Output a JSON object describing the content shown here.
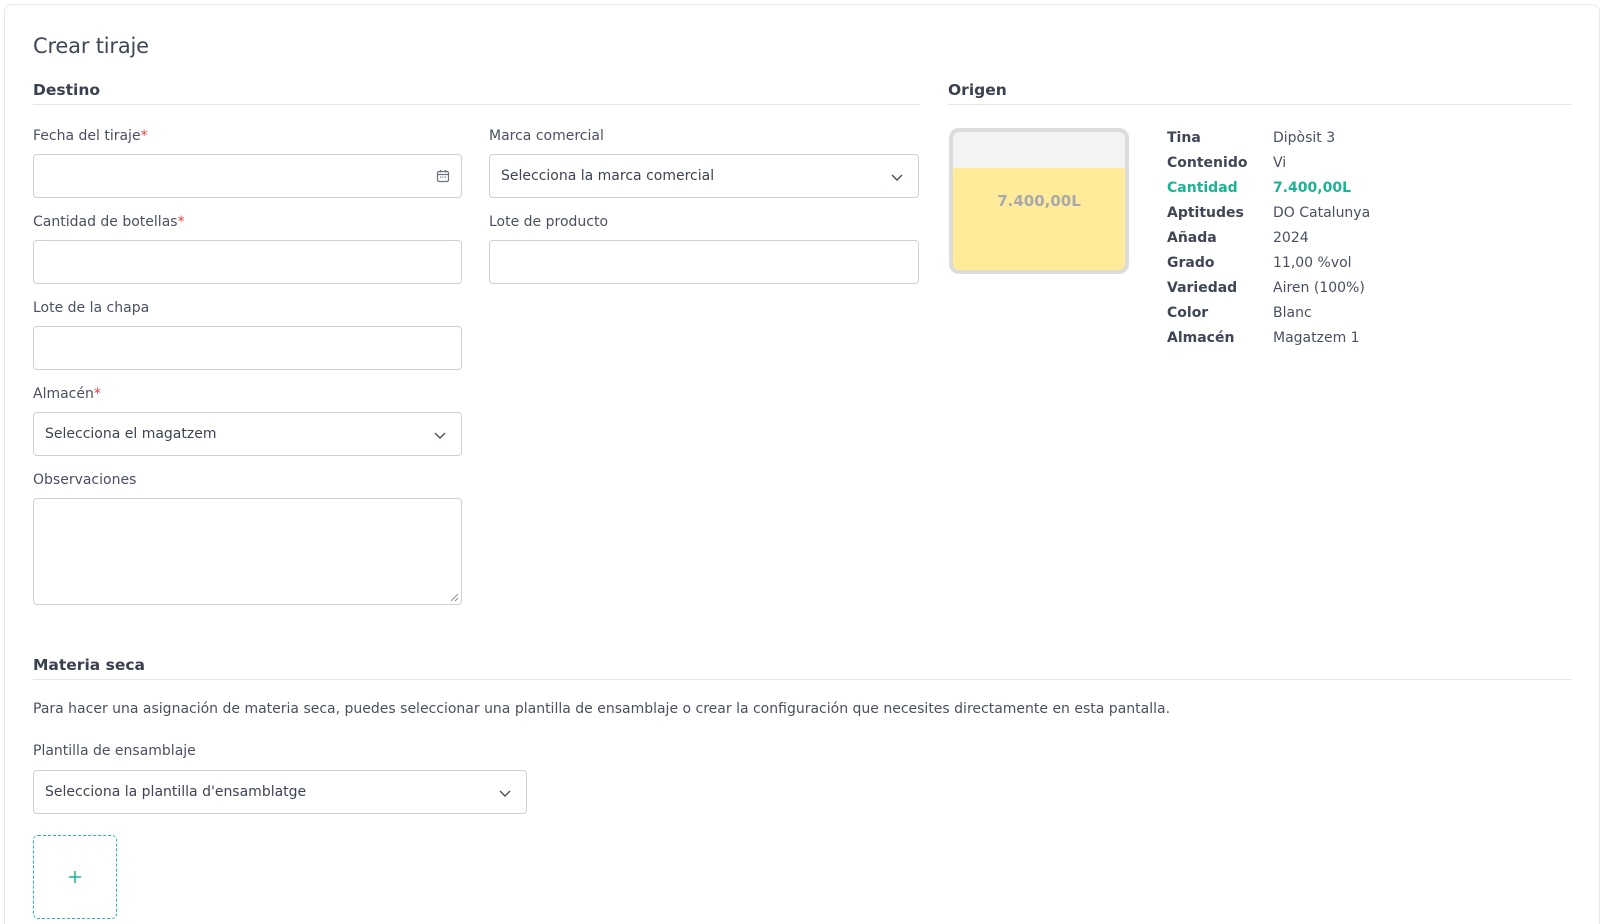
{
  "page": {
    "title": "Crear tiraje"
  },
  "destino": {
    "section_title": "Destino",
    "fecha": {
      "label": "Fecha del tiraje",
      "required_mark": "*",
      "value": ""
    },
    "marca": {
      "label": "Marca comercial",
      "placeholder": "Selecciona la marca comercial"
    },
    "botellas": {
      "label": "Cantidad de botellas",
      "required_mark": "*",
      "value": ""
    },
    "lote_producto": {
      "label": "Lote de producto",
      "value": ""
    },
    "lote_chapa": {
      "label": "Lote de la chapa",
      "value": ""
    },
    "almacen": {
      "label": "Almacén",
      "required_mark": "*",
      "placeholder": "Selecciona el magatzem"
    },
    "observaciones": {
      "label": "Observaciones",
      "value": ""
    }
  },
  "origen": {
    "section_title": "Origen",
    "tank": {
      "label": "7.400,00L",
      "fill_fraction": 0.74,
      "fill_color": "#ffeb99",
      "empty_color": "#f3f3f3"
    },
    "info": [
      {
        "key": "Tina",
        "value": "Dipòsit 3"
      },
      {
        "key": "Contenido",
        "value": "Vi"
      },
      {
        "key": "Cantidad",
        "value": "7.400,00L",
        "highlight": true
      },
      {
        "key": "Aptitudes",
        "value": "DO Catalunya"
      },
      {
        "key": "Añada",
        "value": "2024"
      },
      {
        "key": "Grado",
        "value": "11,00 %vol"
      },
      {
        "key": "Variedad",
        "value": "Airen (100%)"
      },
      {
        "key": "Color",
        "value": "Blanc"
      },
      {
        "key": "Almacén",
        "value": "Magatzem 1"
      }
    ]
  },
  "materia_seca": {
    "section_title": "Materia seca",
    "description": "Para hacer una asignación de materia seca, puedes seleccionar una plantilla de ensamblaje o crear la configuración que necesites directamente en esta pantalla.",
    "plantilla": {
      "label": "Plantilla de ensamblaje",
      "placeholder": "Selecciona la plantilla d'ensamblatge"
    },
    "add_icon": "plus-icon"
  },
  "colors": {
    "accent": "#1ab394",
    "required": "#e53e3e",
    "border": "#cdd1d7"
  }
}
